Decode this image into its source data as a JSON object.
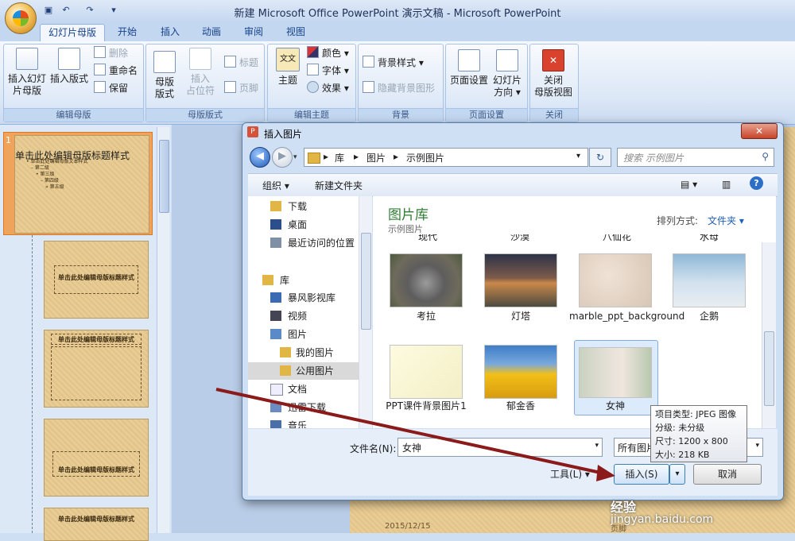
{
  "window": {
    "title": "新建 Microsoft Office PowerPoint 演示文稿 - Microsoft PowerPoint"
  },
  "quick_access": {
    "save_icon": "save-icon",
    "undo_icon": "undo-icon",
    "redo_icon": "redo-icon"
  },
  "ribbon_tabs": [
    "幻灯片母版",
    "开始",
    "插入",
    "动画",
    "审阅",
    "视图"
  ],
  "ribbon": {
    "group_edit_master": {
      "label": "编辑母版",
      "insert_master_line1": "插入幻灯",
      "insert_master_line2": "片母版",
      "insert_layout": "插入版式",
      "delete": "删除",
      "rename": "重命名",
      "preserve": "保留"
    },
    "group_master_layout": {
      "label": "母版版式",
      "master_layout_line1": "母版",
      "master_layout_line2": "版式",
      "insert_placeholder_line1": "插入",
      "insert_placeholder_line2": "占位符",
      "title": "标题",
      "footers": "页脚"
    },
    "group_edit_theme": {
      "label": "编辑主题",
      "theme": "主题",
      "colors": "颜色",
      "fonts": "字体",
      "effects": "效果",
      "theme_icon_text": "文文"
    },
    "group_background": {
      "label": "背景",
      "bg_styles": "背景样式",
      "hide_bg": "隐藏背景图形"
    },
    "group_page_setup": {
      "label": "页面设置",
      "page_setup": "页面设置",
      "orientation_line1": "幻灯片",
      "orientation_line2": "方向"
    },
    "group_close": {
      "label": "关闭",
      "close_line1": "关闭",
      "close_line2": "母版视图"
    }
  },
  "thumbnails": {
    "slide1_number": "1",
    "slide1_title": "单击此处编辑母版标题样式",
    "slide1_bullets": [
      "• 单击此处编辑母版文本样式",
      "– 第二级",
      "• 第三级",
      "– 第四级",
      "» 第五级"
    ],
    "layout_title": "单击此处编辑母版标题样式"
  },
  "slide_footer": {
    "date": "2015/12/15",
    "page": "页脚"
  },
  "dialog": {
    "title": "插入图片",
    "close": "✕",
    "address": [
      "库",
      "图片",
      "示例图片"
    ],
    "search_placeholder": "搜索 示例图片",
    "toolbar": {
      "organize": "组织",
      "new_folder": "新建文件夹"
    },
    "nav": [
      "下载",
      "桌面",
      "最近访问的位置",
      "库",
      "暴风影视库",
      "视频",
      "图片",
      "我的图片",
      "公用图片",
      "文档",
      "迅雷下载",
      "音乐"
    ],
    "library_title": "图片库",
    "library_subtitle": "示例图片",
    "sort_label": "排列方式:",
    "sort_value": "文件夹",
    "files_row0_partial": [
      "现代",
      "沙漠",
      "八仙花",
      "水母"
    ],
    "files": [
      "考拉",
      "灯塔",
      "marble_ppt_background",
      "企鹅",
      "PPT课件背景图片1",
      "郁金香",
      "女神"
    ],
    "tooltip": {
      "type": "项目类型: JPEG 图像",
      "rating": "分级: 未分级",
      "size": "尺寸: 1200 x 800",
      "filesize": "大小: 218 KB"
    },
    "filename_label": "文件名(N):",
    "filename_value": "女神",
    "filetype_value": "所有图片",
    "tools": "工具(L)",
    "insert": "插入(S)",
    "cancel": "取消"
  },
  "watermark": {
    "text": "经验",
    "url": "jingyan.baidu.com"
  }
}
